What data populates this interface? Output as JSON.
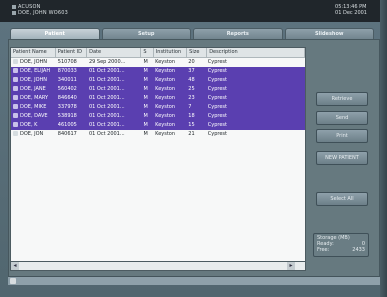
{
  "topbar": {
    "brand_line1": "ACUSON",
    "brand_line2": "DOE, JOHN WO603",
    "time": "05:13:46 PM",
    "date": "01 Dec 2001"
  },
  "tabs": [
    {
      "label": "Patient",
      "active": true
    },
    {
      "label": "Setup",
      "active": false
    },
    {
      "label": "Reports",
      "active": false
    },
    {
      "label": "Slideshow",
      "active": false
    }
  ],
  "grid": {
    "headers": [
      "Patient Name",
      "Patient ID",
      "Date",
      "S",
      "Institution",
      "Size",
      "Description"
    ],
    "rows": [
      {
        "name": "DOE, JOHN",
        "id": "510708",
        "date": "29 Sep 2000...",
        "s": "M",
        "inst": "Keyston",
        "size": "20",
        "desc": "Cyprest",
        "selected": false
      },
      {
        "name": "DOE, ELIJAH",
        "id": "870033",
        "date": "01 Oct 2001...",
        "s": "M",
        "inst": "Keyston",
        "size": "37",
        "desc": "Cyprest",
        "selected": true
      },
      {
        "name": "DOE, JOHN",
        "id": "340011",
        "date": "01 Oct 2001...",
        "s": "M",
        "inst": "Keyston",
        "size": "48",
        "desc": "Cyprest",
        "selected": true
      },
      {
        "name": "DOE, JANE",
        "id": "560402",
        "date": "01 Oct 2001...",
        "s": "M",
        "inst": "Keyston",
        "size": "25",
        "desc": "Cyprest",
        "selected": true
      },
      {
        "name": "DOE, MARY",
        "id": "846640",
        "date": "01 Oct 2001...",
        "s": "M",
        "inst": "Keyston",
        "size": "23",
        "desc": "Cyprest",
        "selected": true
      },
      {
        "name": "DOE, MIKE",
        "id": "337978",
        "date": "01 Oct 2001...",
        "s": "M",
        "inst": "Keyston",
        "size": "7",
        "desc": "Cyprest",
        "selected": true
      },
      {
        "name": "DOE, DAVE",
        "id": "538918",
        "date": "01 Oct 2001...",
        "s": "M",
        "inst": "Keyston",
        "size": "18",
        "desc": "Cyprest",
        "selected": true
      },
      {
        "name": "DOE, K",
        "id": "461005",
        "date": "01 Oct 2001...",
        "s": "M",
        "inst": "Keyston",
        "size": "15",
        "desc": "Cyprest",
        "selected": true
      },
      {
        "name": "DOE, JON",
        "id": "840617",
        "date": "01 Oct 2001...",
        "s": "M",
        "inst": "Keyston",
        "size": "21",
        "desc": "Cyprest",
        "selected": false
      }
    ]
  },
  "buttons": {
    "retrieve": "Retrieve",
    "send": "Send",
    "print": "Print",
    "new_patient": "NEW PATIENT",
    "select_all": "Select All"
  },
  "storage": {
    "title": "Storage (MB)",
    "ready_label": "Ready:",
    "ready_value": "0",
    "free_label": "Free:",
    "free_value": "2433"
  }
}
